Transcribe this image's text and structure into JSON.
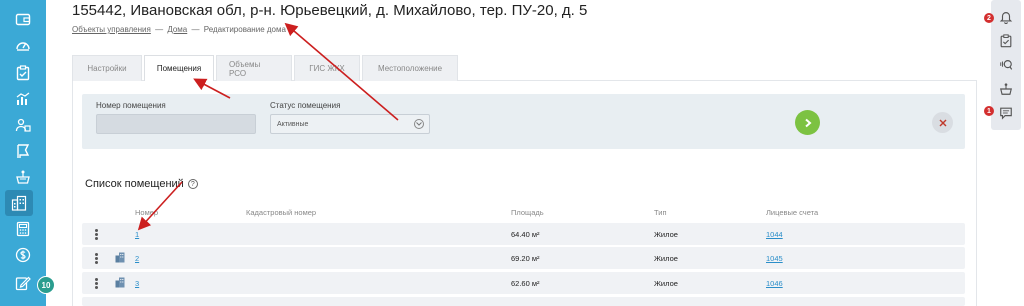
{
  "header": {
    "title": "155442, Ивановская обл, р-н. Юрьевецкий, д. Михайлово, тер. ПУ-20, д. 5",
    "breadcrumb": [
      "Объекты управления",
      "Дома",
      "Редактирование дома"
    ],
    "breadcrumb_sep": "—"
  },
  "tabs": [
    {
      "label": "Настройки",
      "active": false
    },
    {
      "label": "Помещения",
      "active": true
    },
    {
      "label": "Объемы РСО",
      "active": false
    },
    {
      "label": "ГИС ЖКХ",
      "active": false
    },
    {
      "label": "Местоположение",
      "active": false
    }
  ],
  "filter": {
    "room_number_label": "Номер помещения",
    "room_number_value": "",
    "status_label": "Статус помещения",
    "status_value": "Активные"
  },
  "section": {
    "title": "Список помещений",
    "help_icon_text": "?"
  },
  "table": {
    "columns": [
      "Номер",
      "Кадастровый номер",
      "Площадь",
      "Тип",
      "Лицевые счета"
    ],
    "rows": [
      {
        "number": "1",
        "cadastral": "",
        "area": "64.40 м²",
        "type": "Жилое",
        "accounts": "1044"
      },
      {
        "number": "2",
        "cadastral": "",
        "area": "69.20 м²",
        "type": "Жилое",
        "accounts": "1045"
      },
      {
        "number": "3",
        "cadastral": "",
        "area": "62.60 м²",
        "type": "Жилое",
        "accounts": "1046"
      }
    ]
  },
  "sidebar": {
    "icons": [
      "wallet-icon",
      "gauge-icon",
      "clipboard-check-icon",
      "chart-icon",
      "users-icon",
      "flag-icon",
      "basket-icon",
      "building-icon",
      "calculator-icon",
      "dollar-icon",
      "edit-icon"
    ],
    "active_index": 7,
    "badge": "10"
  },
  "right_panel": {
    "icons": [
      "bell-icon",
      "clipboard-icon",
      "audio-icon",
      "basket-icon",
      "message-icon"
    ],
    "bell_badge": "2",
    "message_badge": "1"
  },
  "colors": {
    "sidebar": "#3ba9d6",
    "link": "#2a8ec9",
    "go_button": "#7cc242",
    "badge_red": "#d32f2f",
    "annotation_arrow": "#cc1f1f"
  }
}
